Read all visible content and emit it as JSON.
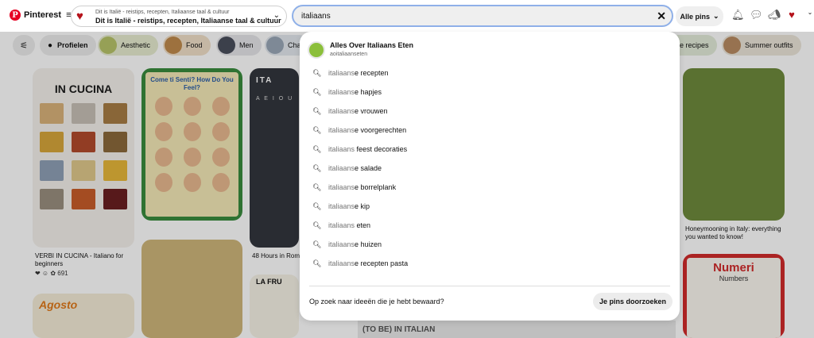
{
  "header": {
    "logo_label": "Pinterest",
    "logo_letter": "P",
    "menu_icon": "hamburger-icon",
    "board": {
      "small": "Dit is Italië - reistips, recepten, Italiaanse taal & cultuur",
      "main": "Dit is Italië - reistips, recepten, Italiaanse taal & cultuur"
    },
    "search": {
      "value": "italiaans"
    },
    "scope_label": "Alle pins"
  },
  "filters": {
    "profiles": "Profielen",
    "chips": [
      "Aesthetic",
      "Food",
      "Men",
      "Cha"
    ],
    "right_chips": [
      "ge recipes",
      "Summer outfits"
    ]
  },
  "pins": {
    "cucina": {
      "title": "IN CUCINA",
      "caption": "VERBI IN CUCINA - Italiano for beginners",
      "count": "691"
    },
    "comesenti": {
      "title": "Come ti Senti? How Do You Feel?"
    },
    "italia": {
      "title": "ITA",
      "sub": "A E I O U",
      "caption": "48 Hours in Rom"
    },
    "honeymoon": {
      "caption": "Honeymooning in Italy: everything you wanted to know!"
    },
    "agosto": {
      "title": "Agosto"
    },
    "frutta": {
      "title": "LA FRU"
    },
    "numeri": {
      "title": "Numeri",
      "sub": "Numbers"
    },
    "bottom_text": "(TO BE) IN ITALIAN"
  },
  "dropdown": {
    "profile": {
      "name": "Alles Over Italiaans Eten",
      "handle": "aoitaliaanseten"
    },
    "suggestions": [
      {
        "prefix": "italiaans",
        "rest": "e recepten"
      },
      {
        "prefix": "italiaans",
        "rest": "e hapjes"
      },
      {
        "prefix": "italiaans",
        "rest": "e vrouwen"
      },
      {
        "prefix": "italiaans",
        "rest": "e voorgerechten"
      },
      {
        "prefix": "italiaans",
        "rest": " feest decoraties"
      },
      {
        "prefix": "italiaans",
        "rest": "e salade"
      },
      {
        "prefix": "italiaans",
        "rest": "e borrelplank"
      },
      {
        "prefix": "italiaans",
        "rest": "e kip"
      },
      {
        "prefix": "italiaans",
        "rest": " eten"
      },
      {
        "prefix": "italiaans",
        "rest": "e huizen"
      },
      {
        "prefix": "italiaans",
        "rest": "e recepten pasta"
      }
    ],
    "footer_question": "Op zoek naar ideeën die je hebt bewaard?",
    "footer_button": "Je pins doorzoeken"
  },
  "colors": {
    "brand": "#e60023",
    "search_border": "#8fb0e8"
  }
}
